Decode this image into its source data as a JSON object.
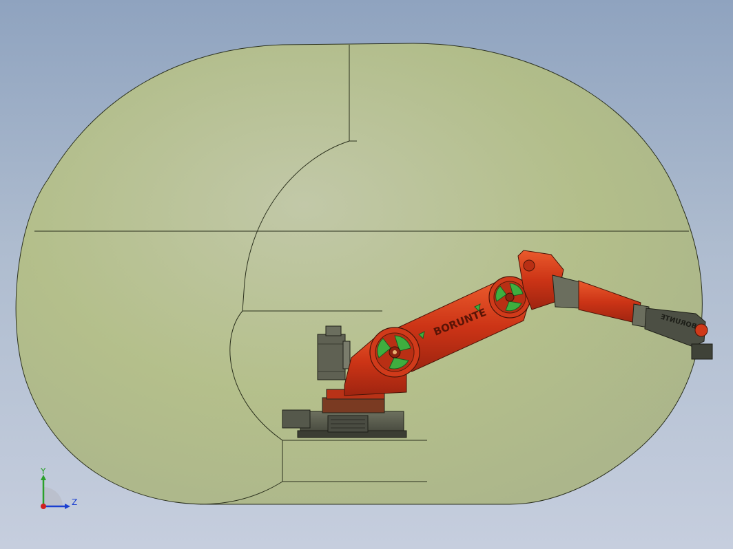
{
  "viewport": {
    "background_top": "#8fa3bf",
    "background_bottom": "#c6cede"
  },
  "envelope": {
    "fill": "#c8d28a",
    "stroke": "#2a2f1c"
  },
  "robot": {
    "brand_label": "BORUNTE",
    "wrist_label": "BORUNTE",
    "body_color": "#d23a1a",
    "joint_accent_color": "#3fae3f",
    "base_color": "#5b5e52"
  },
  "triad": {
    "y_label": "Y",
    "z_label": "Z",
    "y_color": "#2aa02a",
    "z_color": "#1b3fd0",
    "origin_color": "#d02020"
  }
}
